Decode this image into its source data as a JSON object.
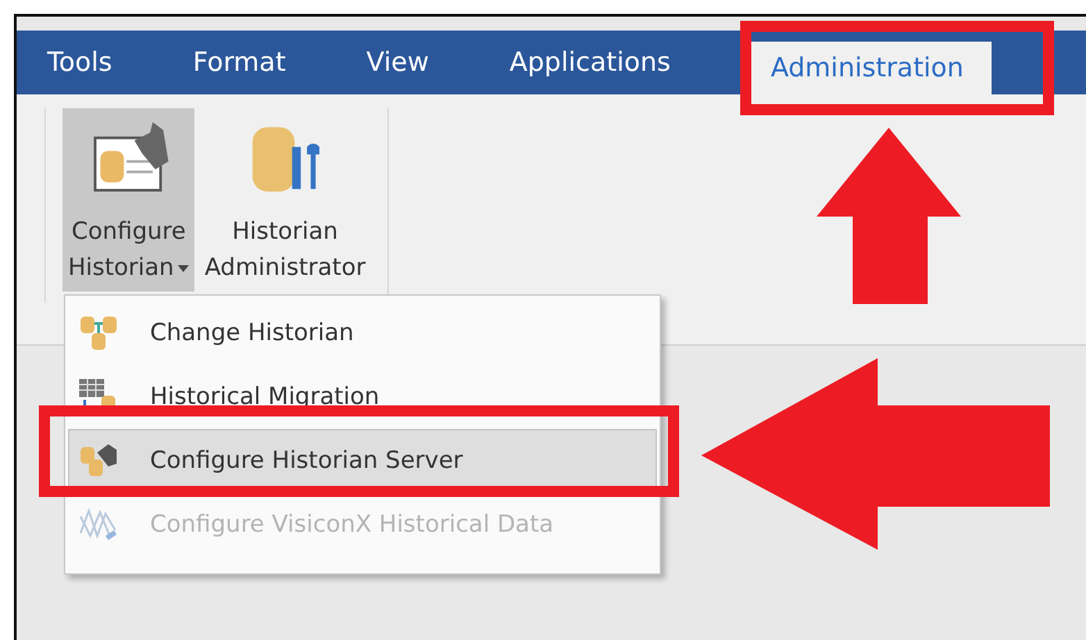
{
  "tabs": [
    {
      "label": "Tools",
      "selected": false
    },
    {
      "label": "Format",
      "selected": false
    },
    {
      "label": "View",
      "selected": false
    },
    {
      "label": "Applications",
      "selected": false
    },
    {
      "label": "Administration",
      "selected": true
    }
  ],
  "ribbon": {
    "buttons": [
      {
        "kind": "configure",
        "lines": [
          "Configure",
          "Historian"
        ],
        "dropdown": true,
        "selected": true
      },
      {
        "kind": "admin",
        "lines": [
          "Historian",
          "Administrator"
        ],
        "dropdown": false,
        "selected": false
      }
    ]
  },
  "menu": {
    "items": [
      {
        "kind": "change",
        "label": "Change Historian",
        "selected": false,
        "disabled": false
      },
      {
        "kind": "migration",
        "label": "Historical Migration",
        "selected": false,
        "disabled": false
      },
      {
        "kind": "server",
        "label": "Configure Historian Server",
        "selected": true,
        "disabled": false
      },
      {
        "kind": "visiconx",
        "label": "Configure VisiconX Historical Data",
        "selected": false,
        "disabled": true
      }
    ]
  }
}
